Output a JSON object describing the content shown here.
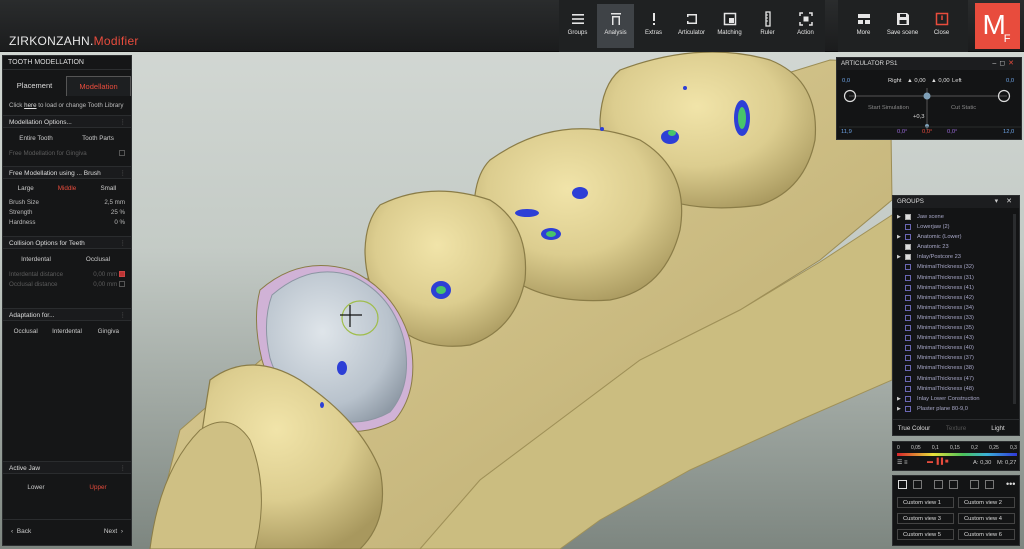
{
  "app": {
    "brand_main": "ZIRKONZAHN.",
    "brand_sub": "Modifier",
    "logo_main": "M",
    "logo_sub": "F"
  },
  "toolbar": {
    "items": [
      {
        "label": "Groups",
        "icon": "menu-icon"
      },
      {
        "label": "Analysis",
        "icon": "analysis-icon"
      },
      {
        "label": "Extras",
        "icon": "exclamation-icon"
      },
      {
        "label": "Articulator",
        "icon": "articulator-icon"
      },
      {
        "label": "Matching",
        "icon": "matching-icon"
      },
      {
        "label": "Ruler",
        "icon": "ruler-icon"
      },
      {
        "label": "Action",
        "icon": "action-icon"
      }
    ],
    "right_items": [
      {
        "label": "More",
        "icon": "more-icon"
      },
      {
        "label": "Save scene",
        "icon": "save-icon"
      },
      {
        "label": "Close",
        "icon": "close-icon"
      }
    ]
  },
  "left_panel": {
    "title": "TOOTH MODELLATION",
    "tab_placement": "Placement",
    "tab_modellation": "Modellation",
    "hint_pre": "Click",
    "hint_link": "here",
    "hint_post": "to load or change Tooth Library",
    "sec_options": "Modellation Options...",
    "opt_entire": "Entire Tooth",
    "opt_parts": "Tooth Parts",
    "free_gingiva": "Free Modellation for Gingiva",
    "free_brush": "Free Modellation using ... Brush",
    "size_large": "Large",
    "size_middle": "Middle",
    "size_small": "Small",
    "brush_size_label": "Brush Size",
    "brush_size_val": "2,5   mm",
    "strength_label": "Strength",
    "strength_val": "25   %",
    "hardness_label": "Hardness",
    "hardness_val": "0   %",
    "sec_collision": "Collision Options for Teeth",
    "coll_interdental": "Interdental",
    "coll_occlusal": "Occlusal",
    "interdental_distance": "Interdental distance",
    "interdental_distance_val": "0,00   mm",
    "occlusal_distance": "Occlusal distance",
    "occlusal_distance_val": "0,00   mm",
    "sec_adaptation": "Adaptation for...",
    "adapt_occlusal": "Occlusal",
    "adapt_interdental": "Interdental",
    "adapt_gingiva": "Gingiva",
    "sec_jaw": "Active Jaw",
    "jaw_lower": "Lower",
    "jaw_upper": "Upper",
    "back": "Back",
    "next": "Next"
  },
  "articulator": {
    "title": "ARTICULATOR PS1",
    "right_label": "Right",
    "right_val": "0,00",
    "left_label": "Left",
    "left_val": "0,00",
    "val_left_top": "0,0",
    "val_right_top": "0,0",
    "start_sim": "Start Simulation",
    "cut_static": "Cut Static",
    "mid_val": "+0,3",
    "bottom_left": "11,9",
    "bottom_right": "12,0",
    "deg1": "0,0°",
    "deg2": "0,0°",
    "deg3": "0,0°"
  },
  "groups": {
    "title": "GROUPS",
    "items": [
      {
        "label": "Jaw scene",
        "tri": "▶",
        "checked": true
      },
      {
        "label": "Lowerjaw (2)",
        "tri": "",
        "checked": false
      },
      {
        "label": "Anatomic (Lower)",
        "tri": "▶",
        "checked": false
      },
      {
        "label": "Anatomic 23",
        "tri": "",
        "checked": true
      },
      {
        "label": "Inlay/Postcore 23",
        "tri": "▶",
        "checked": true
      },
      {
        "label": "MinimalThickness (32)",
        "tri": "",
        "checked": false
      },
      {
        "label": "MinimalThickness (31)",
        "tri": "",
        "checked": false
      },
      {
        "label": "MinimalThickness (41)",
        "tri": "",
        "checked": false
      },
      {
        "label": "MinimalThickness (42)",
        "tri": "",
        "checked": false
      },
      {
        "label": "MinimalThickness (34)",
        "tri": "",
        "checked": false
      },
      {
        "label": "MinimalThickness (33)",
        "tri": "",
        "checked": false
      },
      {
        "label": "MinimalThickness (35)",
        "tri": "",
        "checked": false
      },
      {
        "label": "MinimalThickness (43)",
        "tri": "",
        "checked": false
      },
      {
        "label": "MinimalThickness (40)",
        "tri": "",
        "checked": false
      },
      {
        "label": "MinimalThickness (37)",
        "tri": "",
        "checked": false
      },
      {
        "label": "MinimalThickness (38)",
        "tri": "",
        "checked": false
      },
      {
        "label": "MinimalThickness (47)",
        "tri": "",
        "checked": false
      },
      {
        "label": "MinimalThickness (48)",
        "tri": "",
        "checked": false
      },
      {
        "label": "Inlay Lower Construction",
        "tri": "▶",
        "checked": false
      },
      {
        "label": "Plaster plane 80-9,0",
        "tri": "▶",
        "checked": false
      }
    ],
    "true_colour": "True Colour",
    "texture": "Texture",
    "light": "Light"
  },
  "scale": {
    "ticks": [
      "0",
      "0,05",
      "0,1",
      "0,15",
      "0,2",
      "0,25",
      "0,3"
    ],
    "a_val": "A: 0,30",
    "m_val": "M: 0,27"
  },
  "views": [
    "Custom view 1",
    "Custom view 2",
    "Custom view 3",
    "Custom view 4",
    "Custom view 5",
    "Custom view 6"
  ],
  "colors": {
    "accent": "#e84c3d",
    "tooth": "#d9cb8f",
    "crown": "#bfc9d3",
    "thickness_blue": "#2d3fd6"
  }
}
